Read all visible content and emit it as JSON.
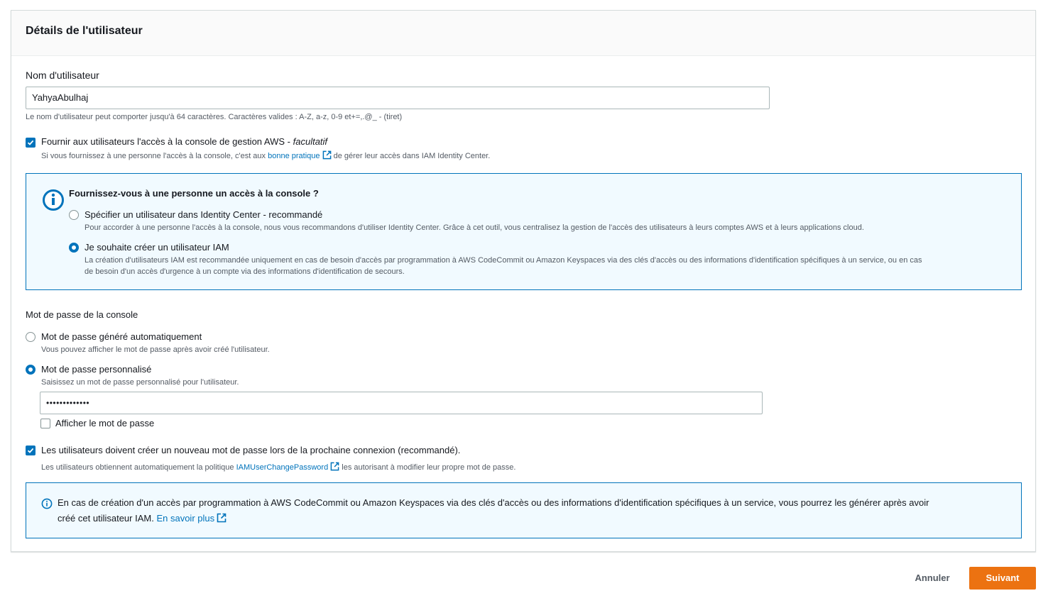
{
  "section": {
    "title": "Détails de l'utilisateur"
  },
  "username": {
    "label": "Nom d'utilisateur",
    "value": "YahyaAbulhaj",
    "hint": "Le nom d'utilisateur peut comporter jusqu'à 64 caractères. Caractères valides : A-Z, a-z, 0-9 et+=,.@_ - (tiret)"
  },
  "console_access": {
    "label": "Fournir aux utilisateurs l'accès à la console de gestion AWS - ",
    "label_optional": "facultatif",
    "hint_before": "Si vous fournissez à une personne l'accès à la console, c'est aux ",
    "hint_link": "bonne pratique",
    "hint_after": " de gérer leur accès dans IAM Identity Center.",
    "checked": true
  },
  "console_question": {
    "title": "Fournissez-vous à une personne un accès à la console ?",
    "options": [
      {
        "label": "Spécifier un utilisateur dans Identity Center - recommandé",
        "desc": "Pour accorder à une personne l'accès à la console, nous vous recommandons d'utiliser Identity Center. Grâce à cet outil, vous centralisez la gestion de l'accès des utilisateurs à leurs comptes AWS et à leurs applications cloud.",
        "selected": false
      },
      {
        "label": "Je souhaite créer un utilisateur IAM",
        "desc_line1": "La création d'utilisateurs IAM est recommandée uniquement en cas de besoin d'accès par programmation à AWS CodeCommit ou Amazon Keyspaces via des clés d'accès ou des informations d'identification spécifiques à un service, ou en cas",
        "desc_line2": "de besoin d'un accès d'urgence à un compte via des informations d'identification de secours.",
        "selected": true
      }
    ]
  },
  "password": {
    "section_label": "Mot de passe de la console",
    "auto": {
      "label": "Mot de passe généré automatiquement",
      "desc": "Vous pouvez afficher le mot de passe après avoir créé l'utilisateur.",
      "selected": false
    },
    "custom": {
      "label": "Mot de passe personnalisé",
      "desc": "Saisissez un mot de passe personnalisé pour l'utilisateur.",
      "selected": true,
      "value": "•••••••••••••"
    },
    "show_label": "Afficher le mot de passe",
    "show_checked": false
  },
  "reset_password": {
    "label": "Les utilisateurs doivent créer un nouveau mot de passe lors de la prochaine connexion (recommandé).",
    "hint_before": "Les utilisateurs obtiennent automatiquement la politique ",
    "hint_link": "IAMUserChangePassword",
    "hint_after": " les autorisant à modifier leur propre mot de passe.",
    "checked": true
  },
  "info_note": {
    "line1": "En cas de création d'un accès par programmation à AWS CodeCommit ou Amazon Keyspaces via des clés d'accès ou des informations d'identification spécifiques à un service, vous pourrez les générer après avoir",
    "line2": "créé cet utilisateur IAM. ",
    "link": "En savoir plus"
  },
  "actions": {
    "cancel": "Annuler",
    "next": "Suivant"
  },
  "colors": {
    "accent": "#0073bb",
    "primary_button": "#ec7211",
    "info_bg": "#f1faff"
  }
}
